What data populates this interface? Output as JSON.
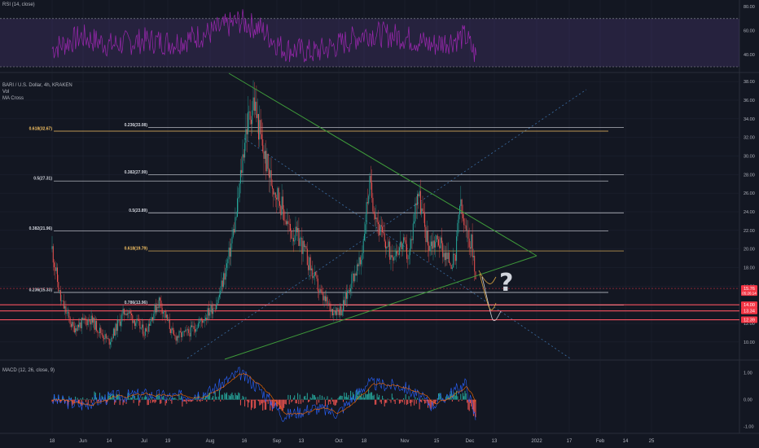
{
  "panes": {
    "rsi": {
      "label": "RSI (14, close)",
      "ticks": [
        "80.00",
        "60.00",
        "40.00"
      ],
      "levels": [
        70,
        30
      ]
    },
    "main": {
      "legend": [
        "BARI / U.S. Dollar, 4h, KRAKEN",
        "Vol",
        "MA Cross"
      ],
      "price_ticks": [
        "38.00",
        "36.00",
        "34.00",
        "32.00",
        "30.00",
        "28.00",
        "26.00",
        "24.00",
        "22.00",
        "20.00",
        "18.00",
        "16.00",
        "14.00",
        "12.00",
        "10.00"
      ],
      "question_mark": "?"
    },
    "macd": {
      "label": "MACD (12, 26, close, 9)",
      "ticks": [
        "1.00",
        "0.00",
        "-1.00"
      ]
    }
  },
  "price_badges": [
    {
      "text": "15.76",
      "sub": "05:26:14",
      "color": "#f23645",
      "kind": "last"
    },
    {
      "text": "14.00",
      "color": "#f23645",
      "kind": "level"
    },
    {
      "text": "13.34",
      "color": "#f23645",
      "kind": "level"
    },
    {
      "text": "12.39",
      "color": "#f23645",
      "kind": "level"
    }
  ],
  "x_axis_ticks": [
    "18",
    "Jun",
    "14",
    "Jul",
    "19",
    "Aug",
    "16",
    "Sep",
    "13",
    "Oct",
    "18",
    "Nov",
    "15",
    "Dec",
    "13",
    "2022",
    "17",
    "Feb",
    "14",
    "25"
  ],
  "fib_levels_left": [
    {
      "label": "0.618(32.67)",
      "price": 32.67,
      "color": "#f5c162"
    },
    {
      "label": "0.5(27.31)",
      "price": 27.31,
      "color": "#d1d4dc"
    },
    {
      "label": "0.382(21.96)",
      "price": 21.96,
      "color": "#d1d4dc"
    },
    {
      "label": "0.236(15.33)",
      "price": 15.33,
      "color": "#d1d4dc"
    }
  ],
  "fib_levels_right": [
    {
      "label": "0.236(33.08)",
      "price": 33.08,
      "color": "#d1d4dc"
    },
    {
      "label": "0.382(27.99)",
      "price": 27.99,
      "color": "#d1d4dc"
    },
    {
      "label": "0.5(23.89)",
      "price": 23.89,
      "color": "#d1d4dc"
    },
    {
      "label": "0.618(19.79)",
      "price": 19.79,
      "color": "#f5c162"
    },
    {
      "label": "0.786(13.96)",
      "price": 13.96,
      "color": "#d1d4dc"
    }
  ],
  "chart_data": {
    "type": "line",
    "symbol": "BARI / U.S. Dollar, 4h, KRAKEN",
    "ylim": [
      9,
      38.5
    ],
    "y_ticks": [
      38,
      36,
      34,
      32,
      30,
      28,
      26,
      24,
      22,
      20,
      18,
      16,
      14,
      12,
      10
    ],
    "series": [
      {
        "name": "BARI / U.S. Dollar",
        "x": [
          "2021-05-18",
          "2021-05-22",
          "2021-05-28",
          "2021-06-05",
          "2021-06-14",
          "2021-06-22",
          "2021-07-01",
          "2021-07-08",
          "2021-07-15",
          "2021-07-22",
          "2021-07-29",
          "2021-08-05",
          "2021-08-10",
          "2021-08-14",
          "2021-08-18",
          "2021-08-22",
          "2021-08-26",
          "2021-08-30",
          "2021-09-03",
          "2021-09-08",
          "2021-09-13",
          "2021-09-18",
          "2021-09-23",
          "2021-09-28",
          "2021-10-03",
          "2021-10-08",
          "2021-10-12",
          "2021-10-16",
          "2021-10-21",
          "2021-10-26",
          "2021-11-01",
          "2021-11-04",
          "2021-11-08",
          "2021-11-13",
          "2021-11-18",
          "2021-11-22",
          "2021-11-26",
          "2021-11-28",
          "2021-12-01",
          "2021-12-04",
          "2021-12-06"
        ],
        "y": [
          20.0,
          14.5,
          11.5,
          12.5,
          10.0,
          13.5,
          11.0,
          14.5,
          10.5,
          11.0,
          12.5,
          14.5,
          19.0,
          24.0,
          32.5,
          36.0,
          31.0,
          27.5,
          25.5,
          22.0,
          21.0,
          18.0,
          15.0,
          13.5,
          13.5,
          17.0,
          18.5,
          27.0,
          22.0,
          19.5,
          20.5,
          19.0,
          26.5,
          20.5,
          21.0,
          19.0,
          18.5,
          25.0,
          21.5,
          20.5,
          15.8
        ]
      }
    ],
    "rsi": {
      "levels": [
        70,
        30
      ],
      "x": [
        "2021-05-18",
        "2021-06-01",
        "2021-06-15",
        "2021-07-01",
        "2021-07-15",
        "2021-08-01",
        "2021-08-15",
        "2021-08-25",
        "2021-09-05",
        "2021-09-20",
        "2021-10-01",
        "2021-10-15",
        "2021-11-01",
        "2021-11-15",
        "2021-12-01",
        "2021-12-06"
      ],
      "y": [
        45,
        55,
        48,
        52,
        50,
        58,
        68,
        62,
        45,
        42,
        48,
        58,
        55,
        48,
        55,
        38
      ]
    },
    "macd": {
      "name": "MACD (12, 26, close, 9)",
      "ylim": [
        -1.1,
        1.2
      ],
      "x": [
        "2021-05-18",
        "2021-06-01",
        "2021-06-15",
        "2021-07-01",
        "2021-07-15",
        "2021-08-01",
        "2021-08-15",
        "2021-08-25",
        "2021-09-05",
        "2021-09-20",
        "2021-10-01",
        "2021-10-15",
        "2021-11-01",
        "2021-11-15",
        "2021-12-01",
        "2021-12-06"
      ],
      "y": [
        0.0,
        -0.2,
        0.1,
        0.2,
        0.1,
        0.3,
        1.0,
        0.4,
        -0.6,
        -0.3,
        -0.5,
        0.6,
        0.5,
        -0.2,
        0.6,
        -0.8
      ]
    }
  },
  "colors": {
    "background": "#131722",
    "grid": "#1f2433",
    "up_candle": "#26a69a",
    "down_candle": "#ef5350",
    "rsi_line": "#9c27b0",
    "trendline": "#3e9a3a",
    "badge_red": "#f23645",
    "level_line": "#f7525f"
  }
}
